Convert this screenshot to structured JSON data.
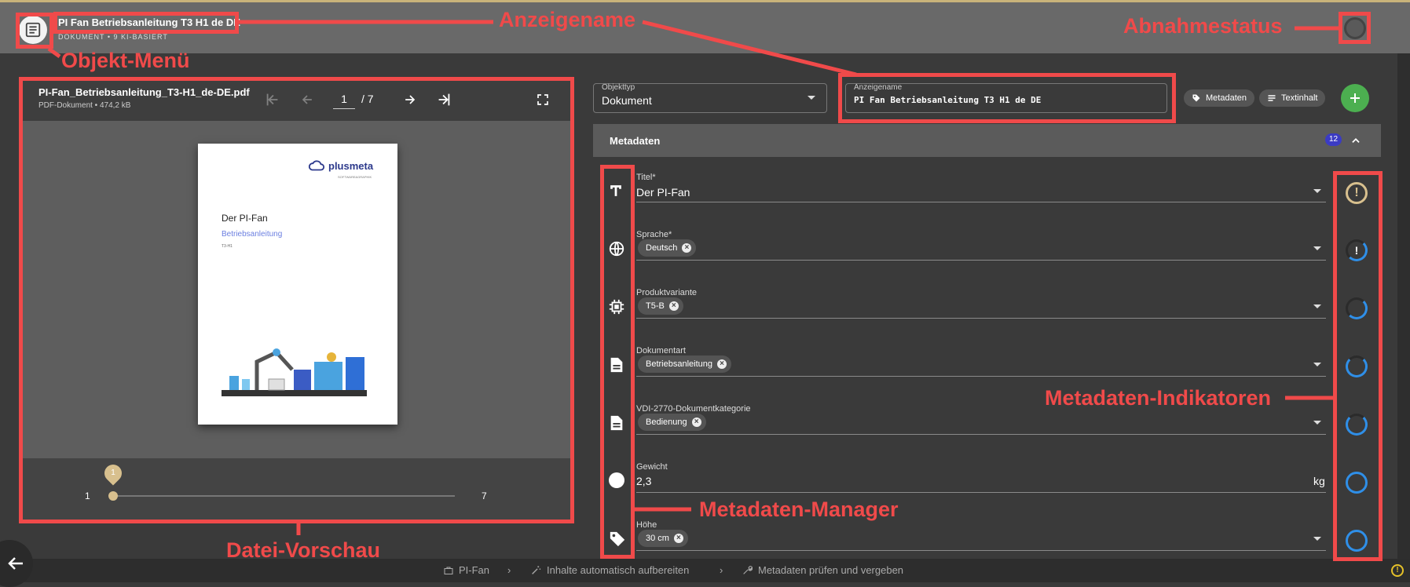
{
  "header": {
    "title": "PI Fan Betriebsanleitung T3 H1 de DE",
    "subtitle": "DOKUMENT • 9 KI-BASIERT"
  },
  "preview": {
    "filename": "PI-Fan_Betriebsanleitung_T3-H1_de-DE.pdf",
    "meta": "PDF-Dokument • 474,2 kB",
    "page_current": "1",
    "page_total": "/ 7",
    "doc": {
      "brand": "plusmeta",
      "brand_sub": "SOFTWARE&GRAPHIK",
      "title": "Der PI-Fan",
      "subtitle": "Betriebsanleitung",
      "small": "T3-H1"
    },
    "slider": {
      "min_label": "1",
      "max_label": "7",
      "thumb": "1",
      "value": 0
    }
  },
  "form": {
    "objekttyp_label": "Objekttyp",
    "objekttyp_value": "Dokument",
    "anzeigename_label": "Anzeigename",
    "anzeigename_value": "PI Fan Betriebsanleitung T3 H1 de DE",
    "pill_metadaten": "Metadaten",
    "pill_textinhalt": "Textinhalt",
    "section_title": "Metadaten",
    "section_count": "12"
  },
  "fields": [
    {
      "label": "Titel*",
      "value": "Der PI-Fan",
      "icon": "text-format-icon"
    },
    {
      "label": "Sprache*",
      "chip": "Deutsch",
      "icon": "globe-icon"
    },
    {
      "label": "Produktvariante",
      "chip": "T5-B",
      "icon": "chip-icon"
    },
    {
      "label": "Dokumentart",
      "chip": "Betriebsanleitung",
      "icon": "document-icon"
    },
    {
      "label": "VDI-2770-Dokumentkategorie",
      "chip": "Bedienung",
      "icon": "document-icon"
    },
    {
      "label": "Gewicht",
      "value": "2,3",
      "unit": "kg",
      "icon": "circle-icon"
    },
    {
      "label": "Höhe",
      "chip": "30 cm",
      "icon": "tag-icon"
    }
  ],
  "annotations": {
    "anzeigename": "Anzeigename",
    "abnahmestatus": "Abnahmestatus",
    "objekt_menu": "Objekt-Menü",
    "datei_vorschau": "Datei-Vorschau",
    "metadaten_manager": "Metadaten-Manager",
    "metadaten_indikatoren": "Metadaten-Indikatoren"
  },
  "breadcrumb": [
    "PI-Fan",
    "Inhalte automatisch aufbereiten",
    "Metadaten prüfen und vergeben"
  ],
  "colors": {
    "annotation": "#f04a4a",
    "accent_blue": "#2f8fe8",
    "add_green": "#4caf50",
    "warning_gold": "#d8c08e"
  }
}
